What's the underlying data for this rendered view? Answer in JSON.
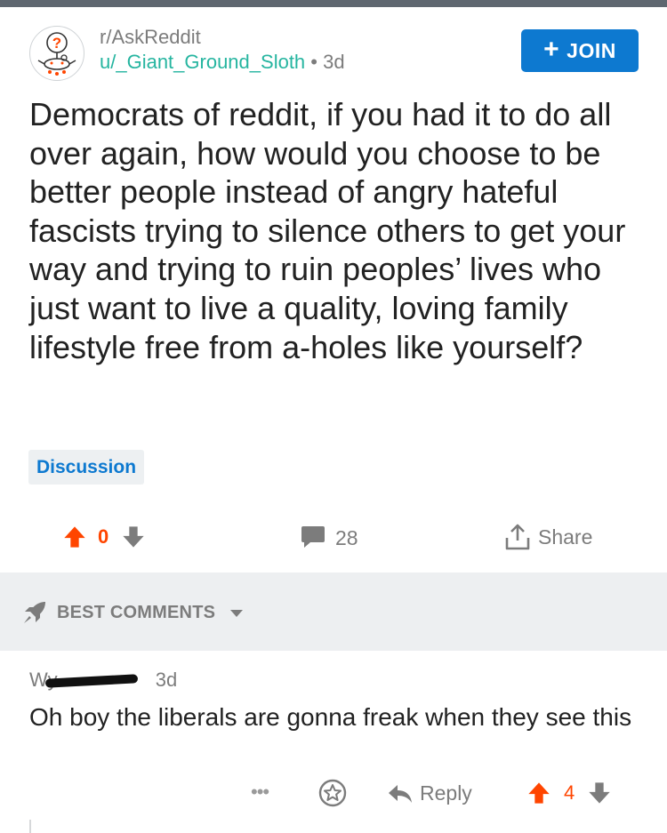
{
  "post": {
    "subreddit": "r/AskReddit",
    "author": "u/_Giant_Ground_Sloth",
    "separator": "•",
    "age": "3d",
    "join_label": "JOIN",
    "join_icon": "plus-icon",
    "title": "Democrats of reddit, if you had it to do all over again, how would you choose to be better people instead of angry hateful fascists trying to silence others to get your way and trying to ruin peoples’ lives who just want to live a quality, loving family lifestyle free from a-holes like yourself?",
    "flair": "Discussion",
    "score": "0",
    "comment_count": "28",
    "share_label": "Share"
  },
  "sort": {
    "label": "BEST COMMENTS"
  },
  "comment": {
    "author_visible": "Wy",
    "age": "3d",
    "body": "Oh boy the liberals are gonna freak when they see this",
    "more_label": "•••",
    "reply_label": "Reply",
    "score": "4"
  },
  "colors": {
    "upvote": "#ff4500",
    "accent": "#0d79d0",
    "username": "#26b5a0",
    "muted": "#7c7c7c",
    "band": "#edeff1",
    "topbar": "#5f6770"
  },
  "icons": [
    "askreddit-snoo-icon",
    "plus-icon",
    "upvote-arrow-icon",
    "downvote-arrow-icon",
    "comment-bubble-icon",
    "share-icon",
    "rocket-icon",
    "caret-down-icon",
    "gild-star-icon",
    "reply-arrow-icon"
  ]
}
